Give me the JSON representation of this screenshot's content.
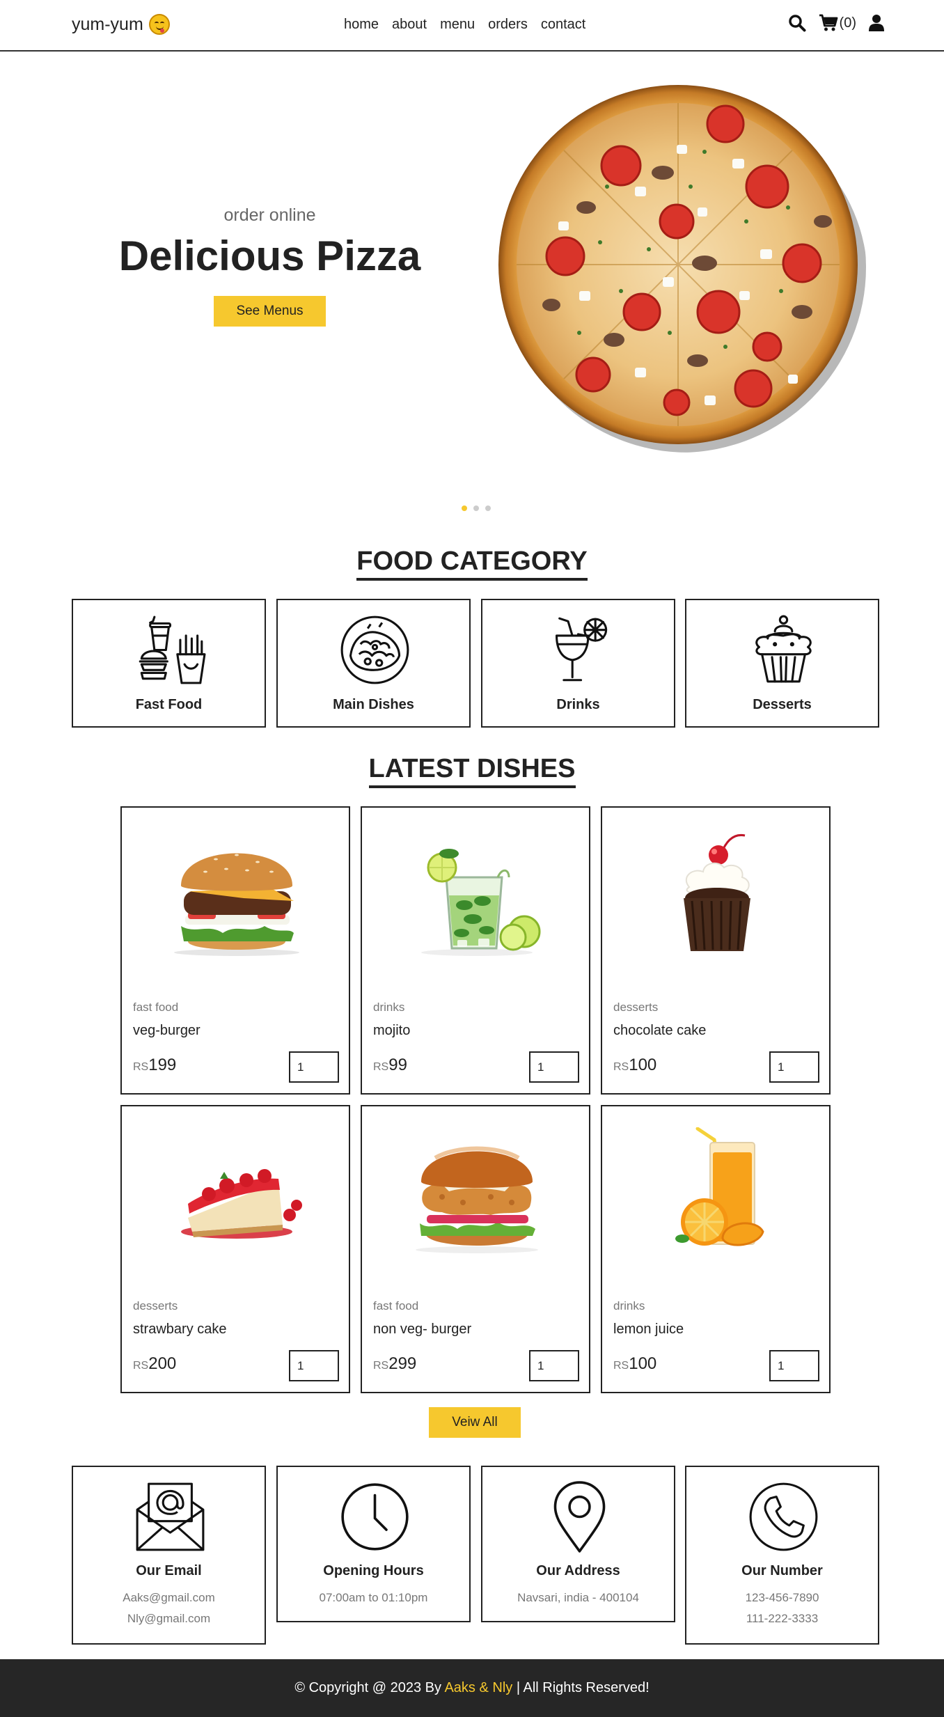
{
  "header": {
    "logo_text": "yum-yum",
    "logo_icon": "face-savoring-food-emoji",
    "nav": [
      "home",
      "about",
      "menu",
      "orders",
      "contact"
    ],
    "cart_count": "(0)"
  },
  "hero": {
    "subtitle": "order online",
    "title": "Delicious Pizza",
    "button": "See Menus",
    "slider_dots": 3,
    "active_dot": 1
  },
  "food_category": {
    "title": "FOOD CATEGORY",
    "items": [
      {
        "label": "Fast Food",
        "icon": "fast-food-icon"
      },
      {
        "label": "Main Dishes",
        "icon": "main-dish-icon"
      },
      {
        "label": "Drinks",
        "icon": "drink-icon"
      },
      {
        "label": "Desserts",
        "icon": "cupcake-icon"
      }
    ]
  },
  "latest_dishes": {
    "title": "LATEST DISHES",
    "currency": "RS",
    "items": [
      {
        "category": "fast food",
        "name": "veg-burger",
        "price": "199",
        "qty": "1",
        "image": "burger"
      },
      {
        "category": "drinks",
        "name": "mojito",
        "price": "99",
        "qty": "1",
        "image": "mojito"
      },
      {
        "category": "desserts",
        "name": "chocolate cake",
        "price": "100",
        "qty": "1",
        "image": "cupcake"
      },
      {
        "category": "desserts",
        "name": "strawbary cake",
        "price": "200",
        "qty": "1",
        "image": "cheesecake"
      },
      {
        "category": "fast food",
        "name": "non veg- burger",
        "price": "299",
        "qty": "1",
        "image": "chicken-burger"
      },
      {
        "category": "drinks",
        "name": "lemon juice",
        "price": "100",
        "qty": "1",
        "image": "orange-juice"
      }
    ],
    "view_all": "Veiw All"
  },
  "info": [
    {
      "title": "Our Email",
      "lines": [
        "Aaks@gmail.com",
        "Nly@gmail.com"
      ],
      "icon": "envelope-icon"
    },
    {
      "title": "Opening Hours",
      "lines": [
        "07:00am to 01:10pm"
      ],
      "icon": "clock-icon"
    },
    {
      "title": "Our Address",
      "lines": [
        "Navsari, india - 400104"
      ],
      "icon": "location-pin-icon"
    },
    {
      "title": "Our Number",
      "lines": [
        "123-456-7890",
        "111-222-3333"
      ],
      "icon": "phone-icon"
    }
  ],
  "footer": {
    "prefix": "© Copyright @ 2023 By ",
    "authors": "Aaks & Nly",
    "suffix": " | All Rights Reserved!"
  },
  "colors": {
    "accent": "#f6c82e",
    "footer_bg": "#262626",
    "text": "#222222"
  }
}
